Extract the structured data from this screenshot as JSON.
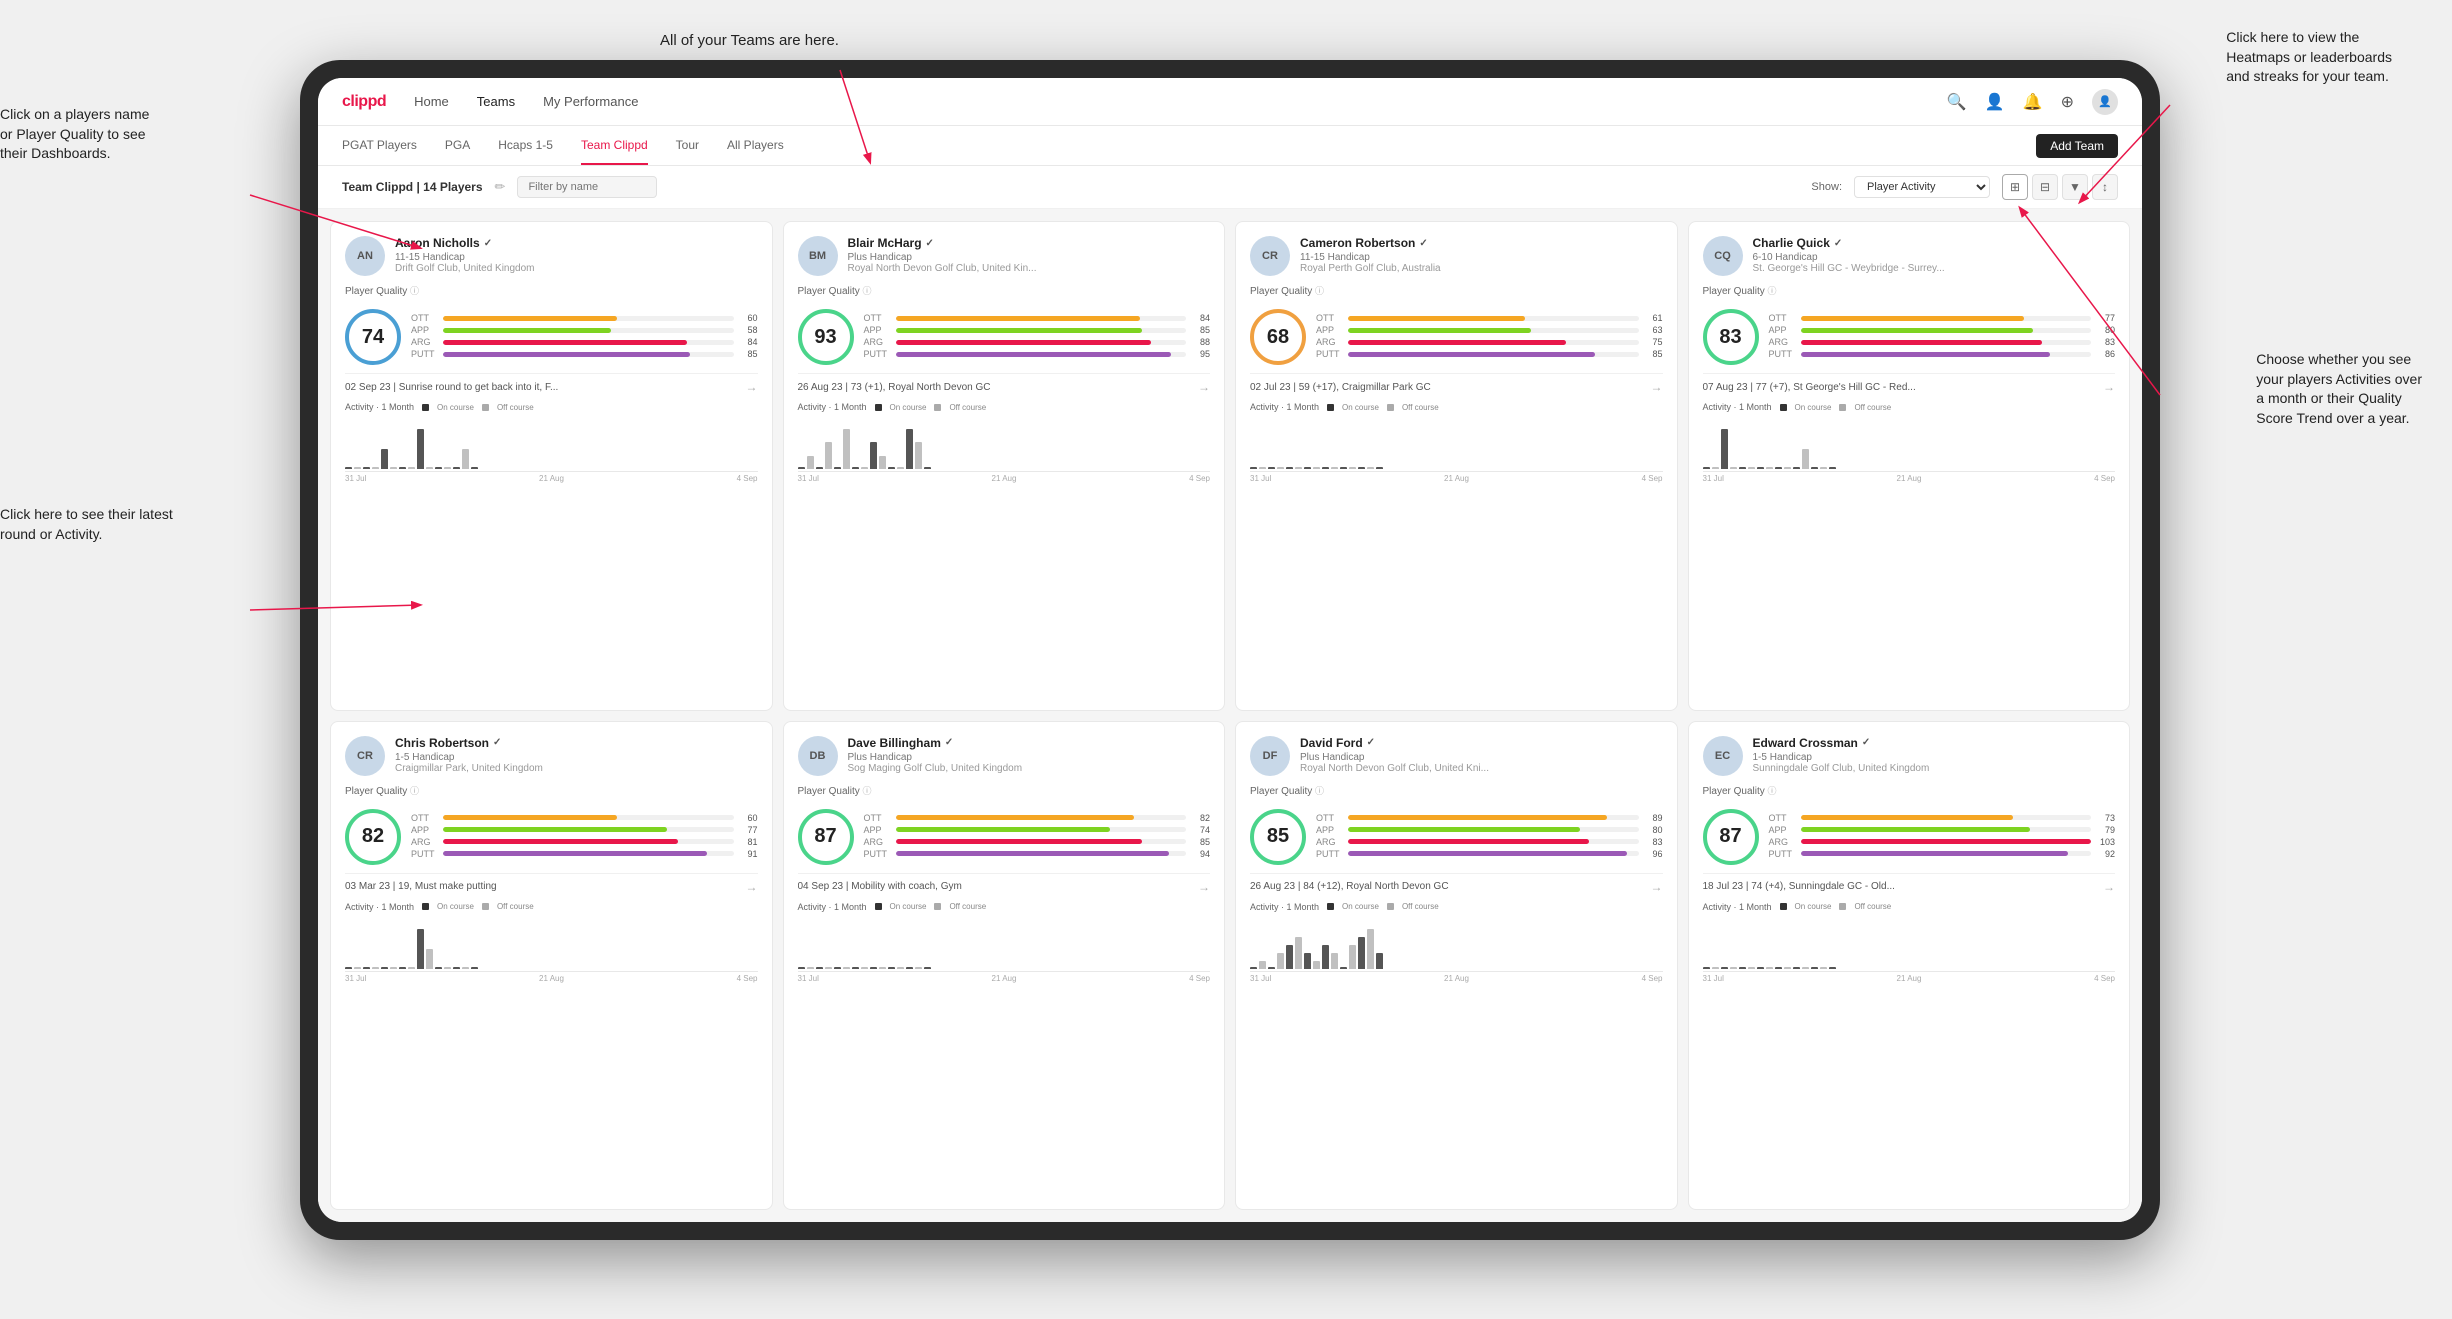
{
  "annotations": {
    "teams": "All of your Teams are here.",
    "heatmaps": "Click here to view the\nHeatmaps or leaderboards\nand streaks for your team.",
    "player_name": "Click on a players name\nor Player Quality to see\ntheir Dashboards.",
    "latest_round": "Click here to see their latest\nround or Activity.",
    "activities": "Choose whether you see\nyour players Activities over\na month or their Quality\nScore Trend over a year."
  },
  "nav": {
    "logo": "clippd",
    "items": [
      "Home",
      "Teams",
      "My Performance"
    ],
    "icons": [
      "🔍",
      "👤",
      "🔔",
      "⊕",
      "👤"
    ]
  },
  "subnav": {
    "items": [
      "PGAT Players",
      "PGA",
      "Hcaps 1-5",
      "Team Clippd",
      "Tour",
      "All Players"
    ],
    "active": "Team Clippd",
    "add_team": "Add Team"
  },
  "toolbar": {
    "title": "Team Clippd | 14 Players",
    "edit_icon": "✏",
    "search_placeholder": "Filter by name",
    "show_label": "Show:",
    "show_option": "Player Activity",
    "views": [
      "⊞",
      "⊟",
      "▼",
      "↕"
    ]
  },
  "players": [
    {
      "name": "Aaron Nicholls",
      "handicap": "11-15 Handicap",
      "club": "Drift Golf Club, United Kingdom",
      "quality": 74,
      "quality_type": "blue",
      "stats": {
        "OTT": {
          "value": 60,
          "pct": 60
        },
        "APP": {
          "value": 58,
          "pct": 58
        },
        "ARG": {
          "value": 84,
          "pct": 84
        },
        "PUTT": {
          "value": 85,
          "pct": 85
        }
      },
      "last_round": "02 Sep 23 | Sunrise round to get back into it, F...",
      "activity_bars": [
        0,
        0,
        0,
        0,
        1,
        0,
        0,
        0,
        2,
        0,
        0,
        0,
        0,
        1,
        0
      ],
      "chart_dates": [
        "31 Jul",
        "21 Aug",
        "4 Sep"
      ]
    },
    {
      "name": "Blair McHarg",
      "handicap": "Plus Handicap",
      "club": "Royal North Devon Golf Club, United Kin...",
      "quality": 93,
      "quality_type": "green",
      "stats": {
        "OTT": {
          "value": 84,
          "pct": 84
        },
        "APP": {
          "value": 85,
          "pct": 85
        },
        "ARG": {
          "value": 88,
          "pct": 88
        },
        "PUTT": {
          "value": 95,
          "pct": 95
        }
      },
      "last_round": "26 Aug 23 | 73 (+1), Royal North Devon GC",
      "activity_bars": [
        0,
        1,
        0,
        2,
        0,
        3,
        0,
        0,
        2,
        1,
        0,
        0,
        3,
        2,
        0
      ],
      "chart_dates": [
        "31 Jul",
        "21 Aug",
        "4 Sep"
      ]
    },
    {
      "name": "Cameron Robertson",
      "handicap": "11-15 Handicap",
      "club": "Royal Perth Golf Club, Australia",
      "quality": 68,
      "quality_type": "orange",
      "stats": {
        "OTT": {
          "value": 61,
          "pct": 61
        },
        "APP": {
          "value": 63,
          "pct": 63
        },
        "ARG": {
          "value": 75,
          "pct": 75
        },
        "PUTT": {
          "value": 85,
          "pct": 85
        }
      },
      "last_round": "02 Jul 23 | 59 (+17), Craigmillar Park GC",
      "activity_bars": [
        0,
        0,
        0,
        0,
        0,
        0,
        0,
        0,
        0,
        0,
        0,
        0,
        0,
        0,
        0
      ],
      "chart_dates": [
        "31 Jul",
        "21 Aug",
        "4 Sep"
      ]
    },
    {
      "name": "Charlie Quick",
      "handicap": "6-10 Handicap",
      "club": "St. George's Hill GC - Weybridge - Surrey...",
      "quality": 83,
      "quality_type": "green",
      "stats": {
        "OTT": {
          "value": 77,
          "pct": 77
        },
        "APP": {
          "value": 80,
          "pct": 80
        },
        "ARG": {
          "value": 83,
          "pct": 83
        },
        "PUTT": {
          "value": 86,
          "pct": 86
        }
      },
      "last_round": "07 Aug 23 | 77 (+7), St George's Hill GC - Red...",
      "activity_bars": [
        0,
        0,
        2,
        0,
        0,
        0,
        0,
        0,
        0,
        0,
        0,
        1,
        0,
        0,
        0
      ],
      "chart_dates": [
        "31 Jul",
        "21 Aug",
        "4 Sep"
      ]
    },
    {
      "name": "Chris Robertson",
      "handicap": "1-5 Handicap",
      "club": "Craigmillar Park, United Kingdom",
      "quality": 82,
      "quality_type": "green",
      "stats": {
        "OTT": {
          "value": 60,
          "pct": 60
        },
        "APP": {
          "value": 77,
          "pct": 77
        },
        "ARG": {
          "value": 81,
          "pct": 81
        },
        "PUTT": {
          "value": 91,
          "pct": 91
        }
      },
      "last_round": "03 Mar 23 | 19, Must make putting",
      "activity_bars": [
        0,
        0,
        0,
        0,
        0,
        0,
        0,
        0,
        2,
        1,
        0,
        0,
        0,
        0,
        0
      ],
      "chart_dates": [
        "31 Jul",
        "21 Aug",
        "4 Sep"
      ]
    },
    {
      "name": "Dave Billingham",
      "handicap": "Plus Handicap",
      "club": "Sog Maging Golf Club, United Kingdom",
      "quality": 87,
      "quality_type": "green",
      "stats": {
        "OTT": {
          "value": 82,
          "pct": 82
        },
        "APP": {
          "value": 74,
          "pct": 74
        },
        "ARG": {
          "value": 85,
          "pct": 85
        },
        "PUTT": {
          "value": 94,
          "pct": 94
        }
      },
      "last_round": "04 Sep 23 | Mobility with coach, Gym",
      "activity_bars": [
        0,
        0,
        0,
        0,
        0,
        0,
        0,
        0,
        0,
        0,
        0,
        0,
        0,
        0,
        0
      ],
      "chart_dates": [
        "31 Jul",
        "21 Aug",
        "4 Sep"
      ]
    },
    {
      "name": "David Ford",
      "handicap": "Plus Handicap",
      "club": "Royal North Devon Golf Club, United Kni...",
      "quality": 85,
      "quality_type": "green",
      "stats": {
        "OTT": {
          "value": 89,
          "pct": 89
        },
        "APP": {
          "value": 80,
          "pct": 80
        },
        "ARG": {
          "value": 83,
          "pct": 83
        },
        "PUTT": {
          "value": 96,
          "pct": 96
        }
      },
      "last_round": "26 Aug 23 | 84 (+12), Royal North Devon GC",
      "activity_bars": [
        0,
        1,
        0,
        2,
        3,
        4,
        2,
        1,
        3,
        2,
        0,
        3,
        4,
        5,
        2
      ],
      "chart_dates": [
        "31 Jul",
        "21 Aug",
        "4 Sep"
      ]
    },
    {
      "name": "Edward Crossman",
      "handicap": "1-5 Handicap",
      "club": "Sunningdale Golf Club, United Kingdom",
      "quality": 87,
      "quality_type": "green",
      "stats": {
        "OTT": {
          "value": 73,
          "pct": 73
        },
        "APP": {
          "value": 79,
          "pct": 79
        },
        "ARG": {
          "value": 103,
          "pct": 100
        },
        "PUTT": {
          "value": 92,
          "pct": 92
        }
      },
      "last_round": "18 Jul 23 | 74 (+4), Sunningdale GC - Old...",
      "activity_bars": [
        0,
        0,
        0,
        0,
        0,
        0,
        0,
        0,
        0,
        0,
        0,
        0,
        0,
        0,
        0
      ],
      "chart_dates": [
        "31 Jul",
        "21 Aug",
        "4 Sep"
      ]
    }
  ]
}
